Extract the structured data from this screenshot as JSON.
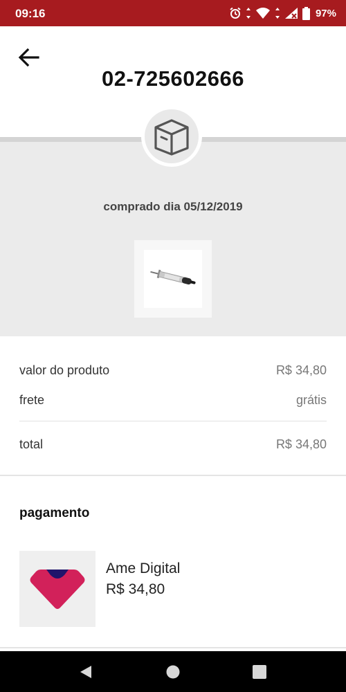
{
  "status_bar": {
    "time": "09:16",
    "battery_percent": "97%",
    "icons": [
      "alarm-icon",
      "data-arrows-icon",
      "wifi-icon",
      "signal-icon",
      "battery-icon"
    ],
    "background": "#a71b1f"
  },
  "header": {
    "back_icon": "arrow-left-icon",
    "order_number": "02-725602666"
  },
  "order": {
    "status_icon": "package-box-icon",
    "purchase_date": "comprado dia 05/12/2019",
    "product_image": "thermal-paste-syringe"
  },
  "summary": {
    "rows": [
      {
        "label": "valor do produto",
        "value": "R$ 34,80"
      },
      {
        "label": "frete",
        "value": "grátis"
      }
    ],
    "total": {
      "label": "total",
      "value": "R$ 34,80"
    }
  },
  "payment": {
    "title": "pagamento",
    "method": "Ame Digital",
    "amount": "R$ 34,80",
    "logo_icon": "ame-digital-logo"
  },
  "navigation": {
    "buttons": [
      "back-triangle-icon",
      "home-circle-icon",
      "recents-square-icon"
    ]
  },
  "colors": {
    "brand_red": "#a71b1f",
    "ame_pink": "#d2215a",
    "ame_navy": "#21146b"
  }
}
